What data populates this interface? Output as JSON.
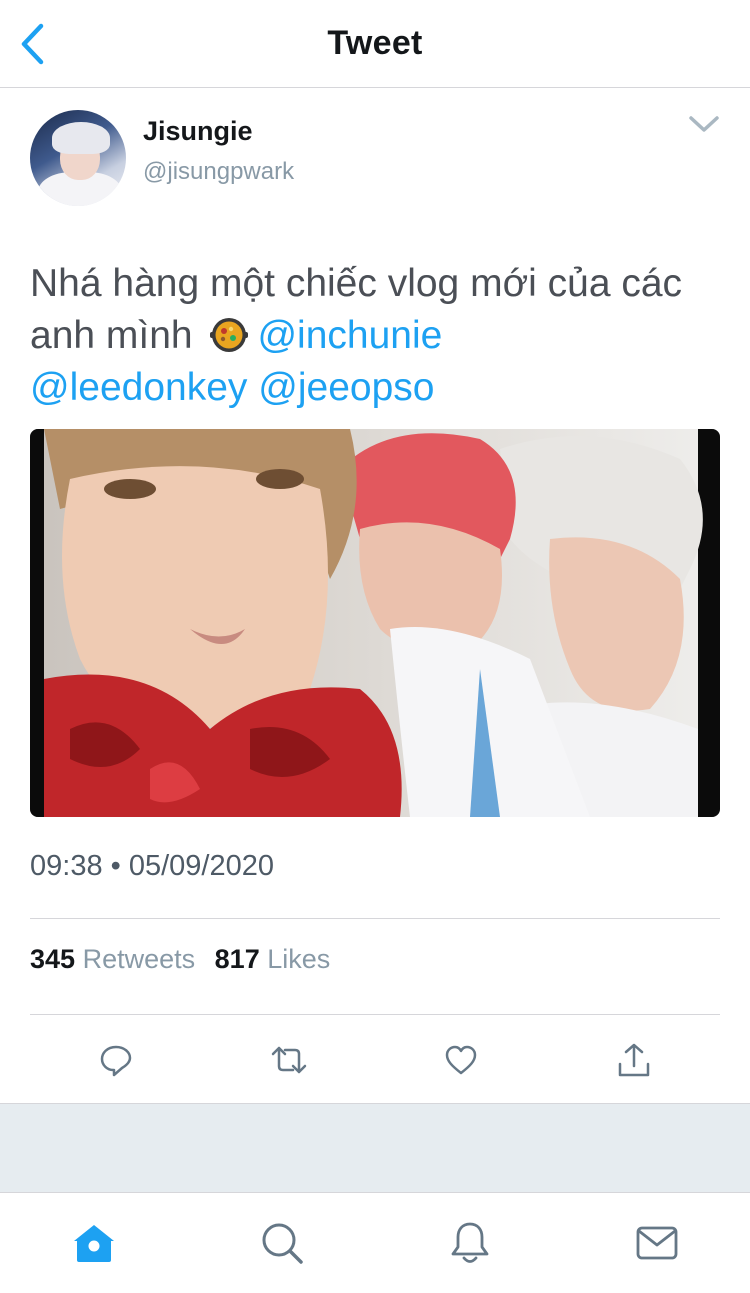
{
  "header": {
    "title": "Tweet",
    "back_icon": "chevron-left-icon"
  },
  "author": {
    "display_name": "Jisungie",
    "handle": "@jisungpwark",
    "menu_icon": "chevron-down-icon"
  },
  "tweet": {
    "text_part1": "Nhá hàng một chiếc vlog mới của các anh mình",
    "emoji": "paella-emoji",
    "mention_1": "@inchunie",
    "mention_2": "@leedonkey",
    "mention_3": "@jeeopso",
    "timestamp": "09:38 • 05/09/2020"
  },
  "stats": {
    "retweets_count": "345",
    "retweets_label": "Retweets",
    "likes_count": "817",
    "likes_label": "Likes"
  },
  "actions": [
    {
      "name": "reply",
      "icon": "reply-icon"
    },
    {
      "name": "retweet",
      "icon": "retweet-icon"
    },
    {
      "name": "like",
      "icon": "heart-icon"
    },
    {
      "name": "share",
      "icon": "share-icon"
    }
  ],
  "tabbar": [
    {
      "name": "home",
      "icon": "home-icon",
      "active": true
    },
    {
      "name": "search",
      "icon": "search-icon",
      "active": false
    },
    {
      "name": "notifications",
      "icon": "bell-icon",
      "active": false
    },
    {
      "name": "messages",
      "icon": "mail-icon",
      "active": false
    }
  ],
  "colors": {
    "accent": "#1da1f2",
    "icon_gray": "#657786",
    "secondary_text": "#8899a6"
  }
}
